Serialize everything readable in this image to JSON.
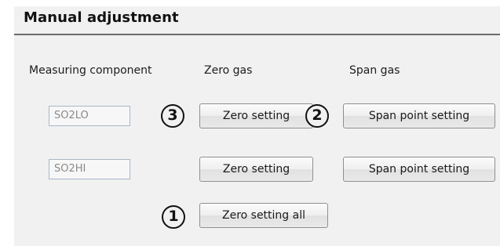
{
  "section": {
    "title": "Manual adjustment"
  },
  "columns": {
    "measuring_component": "Measuring component",
    "zero_gas": "Zero gas",
    "span_gas": "Span gas"
  },
  "rows": [
    {
      "component": "SO2LO",
      "zero_button": "Zero setting",
      "span_button": "Span point setting"
    },
    {
      "component": "SO2HI",
      "zero_button": "Zero setting",
      "span_button": "Span point setting"
    }
  ],
  "zero_all_button": "Zero setting all",
  "callouts": {
    "one": "1",
    "two": "2",
    "three": "3"
  }
}
